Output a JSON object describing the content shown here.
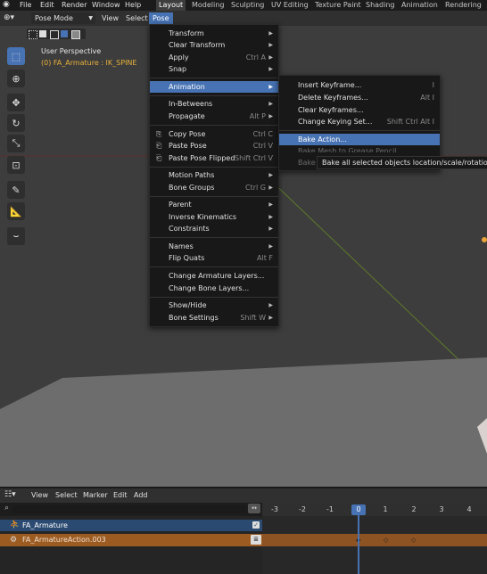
{
  "topbar": {
    "menus": [
      "File",
      "Edit",
      "Render",
      "Window",
      "Help"
    ],
    "workspaces": [
      "Layout",
      "Modeling",
      "Sculpting",
      "UV Editing",
      "Texture Paint",
      "Shading",
      "Animation",
      "Rendering"
    ],
    "active_workspace": "Layout"
  },
  "viewport_header": {
    "mode": "Pose Mode",
    "menus": [
      "View",
      "Select",
      "Pose"
    ]
  },
  "overlay": {
    "view_name": "User Perspective",
    "object_info": "(0) FA_Armature : IK_SPINE"
  },
  "pose_menu": {
    "items": [
      {
        "label": "Transform",
        "shortcut": "",
        "submenu": true
      },
      {
        "label": "Clear Transform",
        "shortcut": "",
        "submenu": true
      },
      {
        "label": "Apply",
        "shortcut": "Ctrl A",
        "submenu": true
      },
      {
        "label": "Snap",
        "shortcut": "",
        "submenu": true
      },
      {
        "label": "Animation",
        "shortcut": "",
        "submenu": true,
        "highlighted": true
      },
      {
        "label": "In-Betweens",
        "shortcut": "",
        "submenu": true
      },
      {
        "label": "Propagate",
        "shortcut": "Alt P",
        "submenu": true
      },
      {
        "label": "Copy Pose",
        "shortcut": "Ctrl C",
        "submenu": false
      },
      {
        "label": "Paste Pose",
        "shortcut": "Ctrl V",
        "submenu": false
      },
      {
        "label": "Paste Pose Flipped",
        "shortcut": "Shift Ctrl V",
        "submenu": false
      },
      {
        "label": "Motion Paths",
        "shortcut": "",
        "submenu": true
      },
      {
        "label": "Bone Groups",
        "shortcut": "Ctrl G",
        "submenu": true
      },
      {
        "label": "Parent",
        "shortcut": "",
        "submenu": true
      },
      {
        "label": "Inverse Kinematics",
        "shortcut": "",
        "submenu": true
      },
      {
        "label": "Constraints",
        "shortcut": "",
        "submenu": true
      },
      {
        "label": "Names",
        "shortcut": "",
        "submenu": true
      },
      {
        "label": "Flip Quats",
        "shortcut": "Alt F",
        "submenu": false
      },
      {
        "label": "Change Armature Layers...",
        "shortcut": "",
        "submenu": false
      },
      {
        "label": "Change Bone Layers...",
        "shortcut": "",
        "submenu": false
      },
      {
        "label": "Show/Hide",
        "shortcut": "",
        "submenu": true
      },
      {
        "label": "Bone Settings",
        "shortcut": "Shift W",
        "submenu": true
      }
    ]
  },
  "animation_menu": {
    "items": [
      {
        "label": "Insert Keyframe...",
        "shortcut": "I"
      },
      {
        "label": "Delete Keyframes...",
        "shortcut": "Alt I"
      },
      {
        "label": "Clear Keyframes...",
        "shortcut": ""
      },
      {
        "label": "Change Keying Set...",
        "shortcut": "Shift Ctrl Alt I"
      },
      {
        "label": "Bake Action...",
        "shortcut": ""
      },
      {
        "label": "Bake Mesh to Grease Pencil",
        "shortcut": ""
      },
      {
        "label": "Bake",
        "shortcut": ""
      }
    ],
    "tooltip": "Bake all selected objects location/scale/rotation animat"
  },
  "timeline": {
    "menus": [
      "View",
      "Select",
      "Marker",
      "Edit",
      "Add"
    ],
    "frames": [
      "-3",
      "-2",
      "-1",
      "0",
      "1",
      "2",
      "3",
      "4"
    ],
    "current_frame": "0",
    "channels": [
      {
        "name": "FA_Armature"
      },
      {
        "name": "FA_ArmatureAction.003"
      }
    ]
  },
  "colors": {
    "accent": "#4772b3",
    "action_row": "#9c5b21",
    "object_row": "#2b4a72",
    "overlay_text": "#e8b13a"
  }
}
